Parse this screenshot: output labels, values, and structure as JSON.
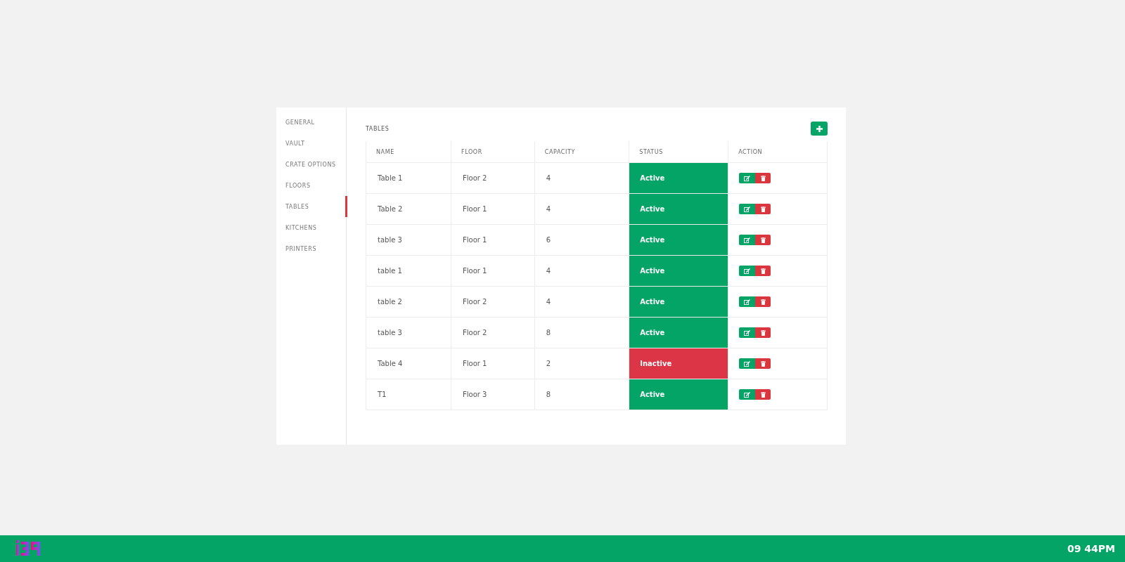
{
  "sidebar": {
    "items": [
      {
        "label": "GENERAL",
        "selected": false
      },
      {
        "label": "VAULT",
        "selected": false
      },
      {
        "label": "CRATE OPTIONS",
        "selected": false
      },
      {
        "label": "FLOORS",
        "selected": false
      },
      {
        "label": "TABLES",
        "selected": true
      },
      {
        "label": "KITCHENS",
        "selected": false
      },
      {
        "label": "PRINTERS",
        "selected": false
      }
    ]
  },
  "section_title": "TABLES",
  "table": {
    "columns": [
      "NAME",
      "FLOOR",
      "CAPACITY",
      "STATUS",
      "ACTION"
    ],
    "rows": [
      {
        "name": "Table 1",
        "floor": "Floor 2",
        "capacity": "4",
        "status": "Active",
        "active": true
      },
      {
        "name": "Table 2",
        "floor": "Floor 1",
        "capacity": "4",
        "status": "Active",
        "active": true
      },
      {
        "name": "table 3",
        "floor": "Floor 1",
        "capacity": "6",
        "status": "Active",
        "active": true
      },
      {
        "name": "table 1",
        "floor": "Floor 1",
        "capacity": "4",
        "status": "Active",
        "active": true
      },
      {
        "name": "table 2",
        "floor": "Floor 2",
        "capacity": "4",
        "status": "Active",
        "active": true
      },
      {
        "name": "table 3",
        "floor": "Floor 2",
        "capacity": "8",
        "status": "Active",
        "active": true
      },
      {
        "name": "Table 4",
        "floor": "Floor 1",
        "capacity": "2",
        "status": "Inactive",
        "active": false
      },
      {
        "name": "T1",
        "floor": "Floor 3",
        "capacity": "8",
        "status": "Active",
        "active": true
      }
    ]
  },
  "status_bar": {
    "time": "09 44PM"
  }
}
